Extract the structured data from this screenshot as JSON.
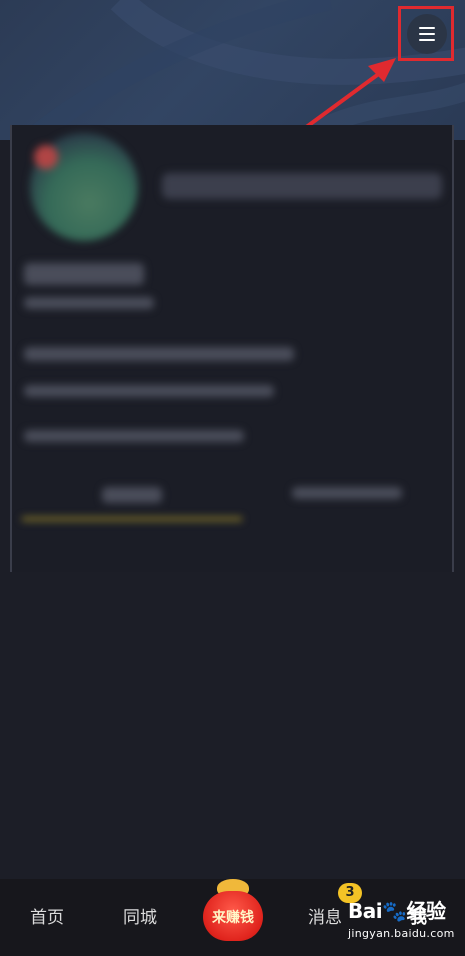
{
  "nav": {
    "home": "首页",
    "local": "同城",
    "earn": "来赚钱",
    "messages": "消息",
    "messages_badge": "3",
    "me": "我"
  },
  "watermark": {
    "brand": "Bai",
    "brand_suffix": "经验",
    "site": "jingyan.baidu.com"
  },
  "icons": {
    "menu": "hamburger-menu-icon",
    "earn": "red-lucky-bag-icon",
    "watermark": "paw-icon"
  },
  "colors": {
    "annotation": "#e02a2f",
    "badge": "#f4c326",
    "background": "#1c1e27"
  }
}
